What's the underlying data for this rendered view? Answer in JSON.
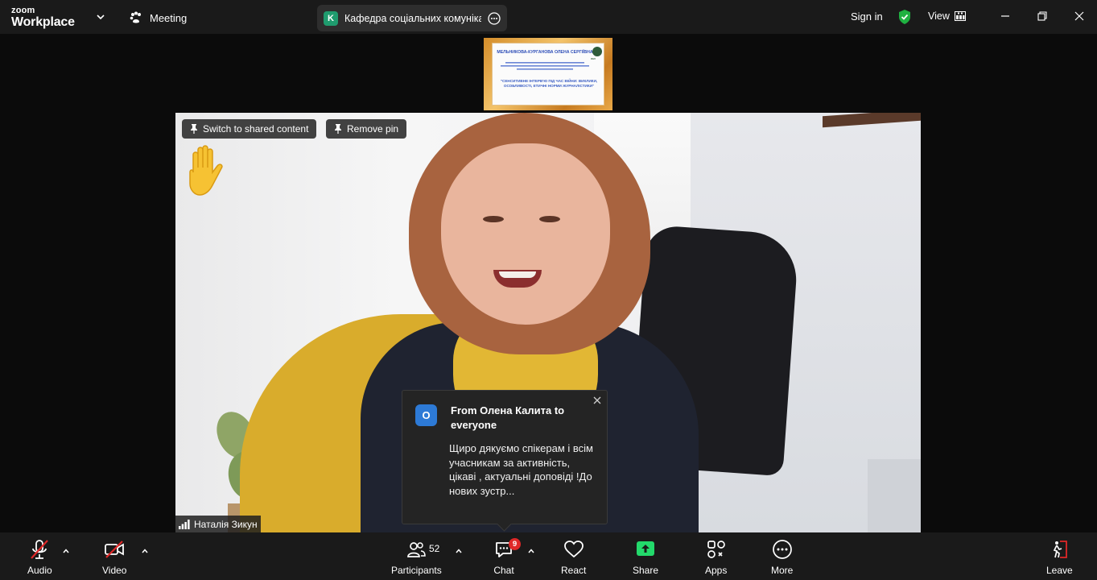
{
  "titlebar": {
    "brand_small": "zoom",
    "brand_big": "Workplace",
    "meeting_label": "Meeting",
    "meeting_avatar_letter": "K",
    "meeting_name": "Кафедра соціальних комунікац",
    "signin_label": "Sign in",
    "view_label": "View"
  },
  "shared_thumbnail": {
    "speaker_name": "МЕЛЬНИКОВА-КУРГАНОВА ОЛЕНА СЕРГІЇВНА",
    "topic": "\"СЕНСИТИВНЕ ІНТЕРВ'Ю ПІД ЧАС ВІЙНИ: ВИКЛИКИ, ОСОБЛИВОСТІ, ЕТИЧНІ НОРМИ ЖУРНАЛІСТИКИ\"",
    "logo_label": "ЛНУ"
  },
  "video": {
    "switch_button": "Switch to shared content",
    "remove_pin_button": "Remove pin",
    "participant_name": "Наталія Зикун"
  },
  "chat_popup": {
    "avatar_letter": "О",
    "from": "From Олена Калита to everyone",
    "message": "Щиро дякуємо спікерам і всім учасникам за активність, цікаві , актуальні доповіді !До нових зустр..."
  },
  "toolbar": {
    "audio": "Audio",
    "video": "Video",
    "participants": "Participants",
    "participants_count": "52",
    "chat": "Chat",
    "chat_badge": "9",
    "react": "React",
    "share": "Share",
    "apps": "Apps",
    "more": "More",
    "leave": "Leave"
  },
  "colors": {
    "toolbar_bg": "#1a1a1a",
    "share_green": "#23d96b",
    "shield_green": "#1fb141",
    "badge_red": "#e02828",
    "mute_red": "#e02828"
  }
}
